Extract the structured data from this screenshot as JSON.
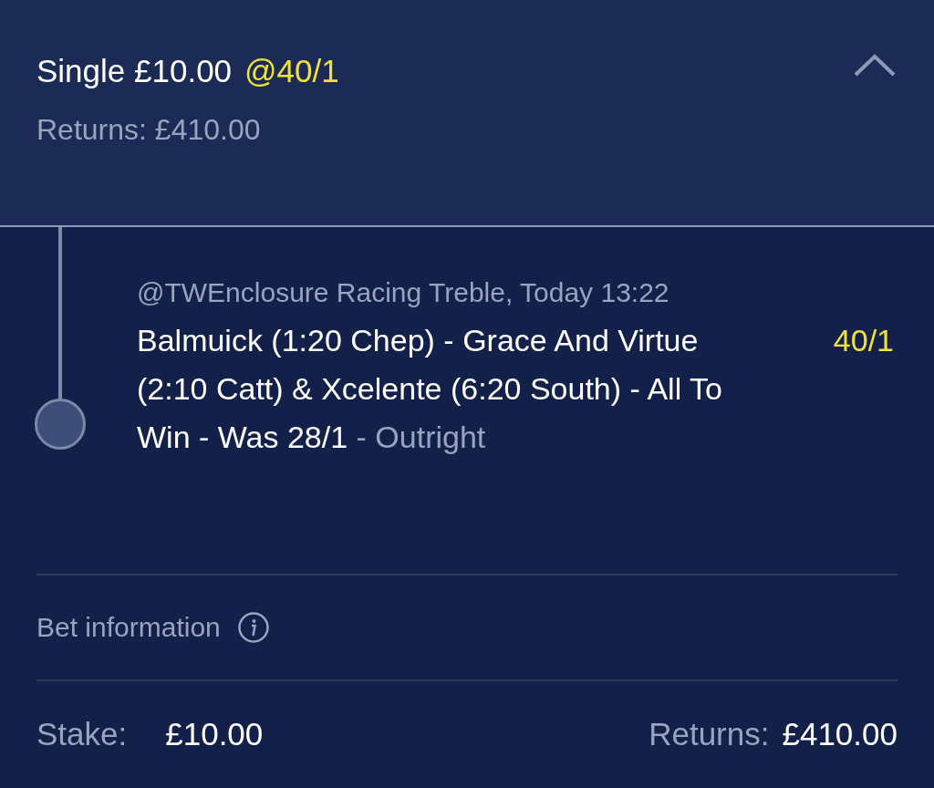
{
  "bet": {
    "type": "Single",
    "stake": "£10.00",
    "odds": "@40/1",
    "returns": "Returns: £410.00",
    "expanded": true
  },
  "selection": {
    "meta": "@TWEnclosure Racing Treble, Today 13:22",
    "description": "Balmuick (1:20 Chep) - Grace And Virtue (2:10 Catt) & Xcelente (6:20 South) - All To Win - Was 28/1",
    "market": "- Outright",
    "odds": "40/1"
  },
  "bet_information": "Bet information",
  "footer": {
    "stake_label": "Stake:",
    "stake": "£10.00",
    "returns_label": "Returns:",
    "returns": "£410.00"
  }
}
